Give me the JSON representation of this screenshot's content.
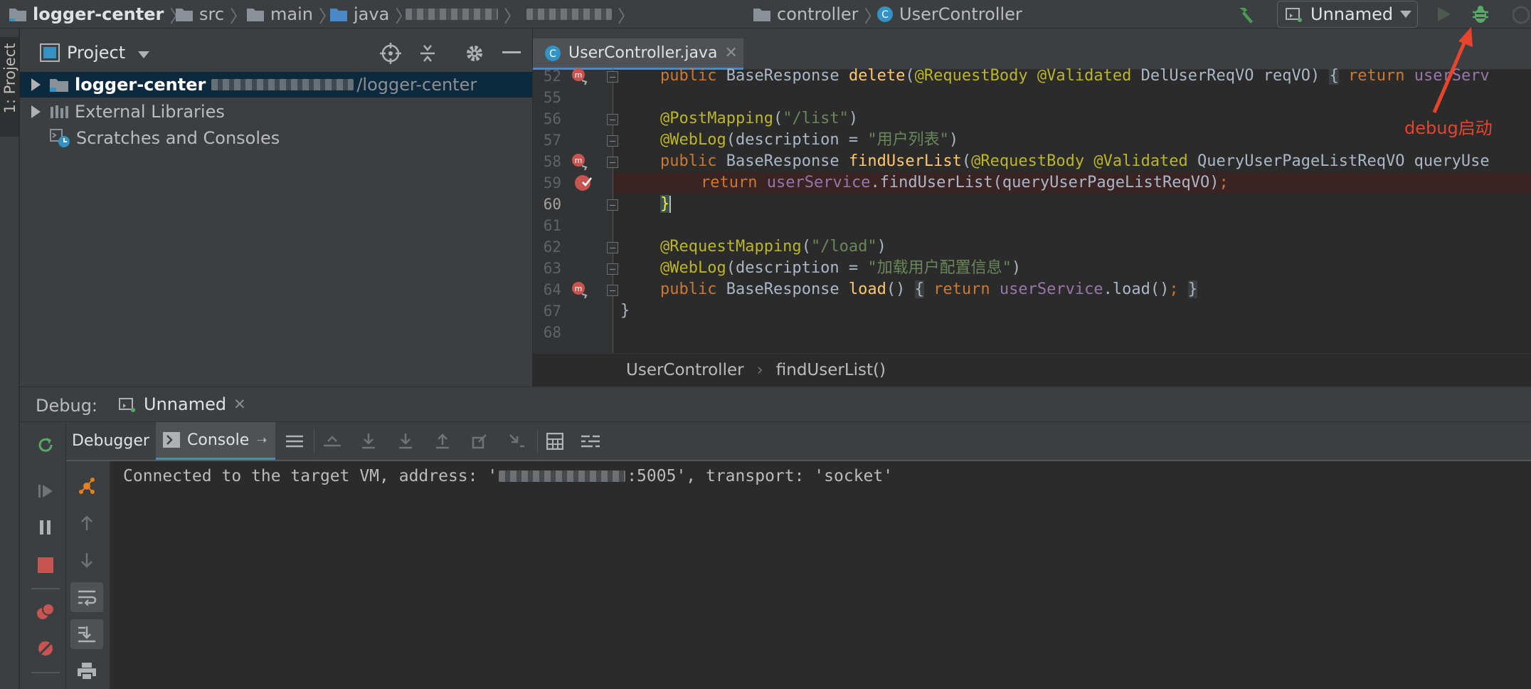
{
  "navbar": {
    "crumbs": [
      "logger-center",
      "src",
      "main",
      "java",
      "controller",
      "UserController"
    ],
    "run_config": "Unnamed"
  },
  "stripe": {
    "label": "1: Project"
  },
  "project": {
    "title": "Project",
    "tree": [
      {
        "label": "logger-center",
        "suffix": "logger-center"
      },
      {
        "label": "External Libraries"
      },
      {
        "label": "Scratches and Consoles"
      }
    ]
  },
  "editor": {
    "tab": "UserController.java",
    "line_numbers": [
      "52",
      "55",
      "56",
      "57",
      "58",
      "59",
      "60",
      "61",
      "62",
      "63",
      "64",
      "67",
      "68"
    ],
    "breadcrumb": [
      "UserController",
      "findUserList()"
    ]
  },
  "annotation": {
    "label": "debug启动",
    "color": "#e8442c"
  },
  "debug": {
    "label": "Debug:",
    "session": "Unnamed",
    "tabs": [
      "Debugger",
      "Console"
    ],
    "console_line": "Connected to the target VM, address: '",
    "console_port": ":5005', transport: 'socket'"
  },
  "colors": {
    "keyword": "#cc7832",
    "annotation": "#bbb529",
    "string": "#6a8759",
    "method": "#ffc66d",
    "field": "#9876aa",
    "accent": "#4a88c7"
  }
}
